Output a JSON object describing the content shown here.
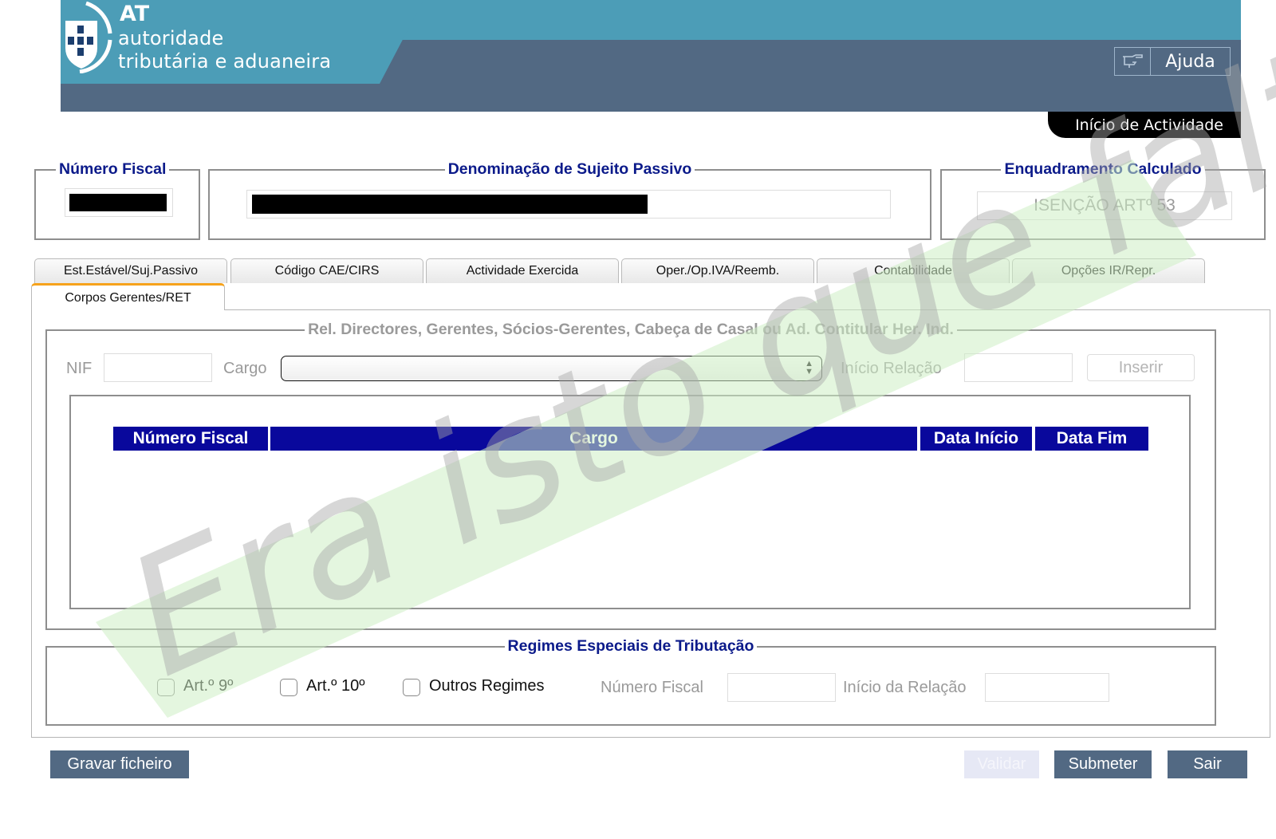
{
  "header": {
    "logo": {
      "line_at": "AT",
      "line1": "autoridade",
      "line2": "tributária e aduaneira"
    },
    "help_label": "Ajuda",
    "page_tag": "Início de Actividade"
  },
  "summary": {
    "numero_fiscal_label": "Número Fiscal",
    "denominacao_label": "Denominação de Sujeito Passivo",
    "enquadramento_label": "Enquadramento Calculado",
    "enquadramento_value": "ISENÇÃO ARTº 53"
  },
  "tabs": [
    {
      "label": "Est.Estável/Suj.Passivo"
    },
    {
      "label": "Código CAE/CIRS"
    },
    {
      "label": "Actividade Exercida"
    },
    {
      "label": "Oper./Op.IVA/Reemb."
    },
    {
      "label": "Contabilidade"
    },
    {
      "label": "Opções IR/Repr."
    },
    {
      "label": "Corpos Gerentes/RET",
      "active": true
    }
  ],
  "directors": {
    "legend": "Rel. Directores, Gerentes, Sócios-Gerentes, Cabeça de Casal ou Ad. Contitular Her. Ind.",
    "nif_label": "NIF",
    "cargo_label": "Cargo",
    "inicio_label": "Início Relação",
    "insert_label": "Inserir",
    "table_headers": [
      "Número Fiscal",
      "Cargo",
      "Data Início",
      "Data Fim"
    ]
  },
  "regimes": {
    "legend": "Regimes Especiais de Tributação",
    "options": [
      "Art.º 9º",
      "Art.º 10º",
      "Outros Regimes"
    ],
    "numero_fiscal_label": "Número Fiscal",
    "inicio_label": "Início da Relação"
  },
  "footer": {
    "save_label": "Gravar ficheiro",
    "validate_label": "Validar",
    "submit_label": "Submeter",
    "exit_label": "Sair"
  },
  "watermark": "Era isto que faltava!",
  "colors": {
    "header_teal": "#4c9db7",
    "header_slate": "#526983",
    "title_blue": "#0b1a8a",
    "table_header": "#09089c",
    "tab_accent": "#f6a21b"
  }
}
